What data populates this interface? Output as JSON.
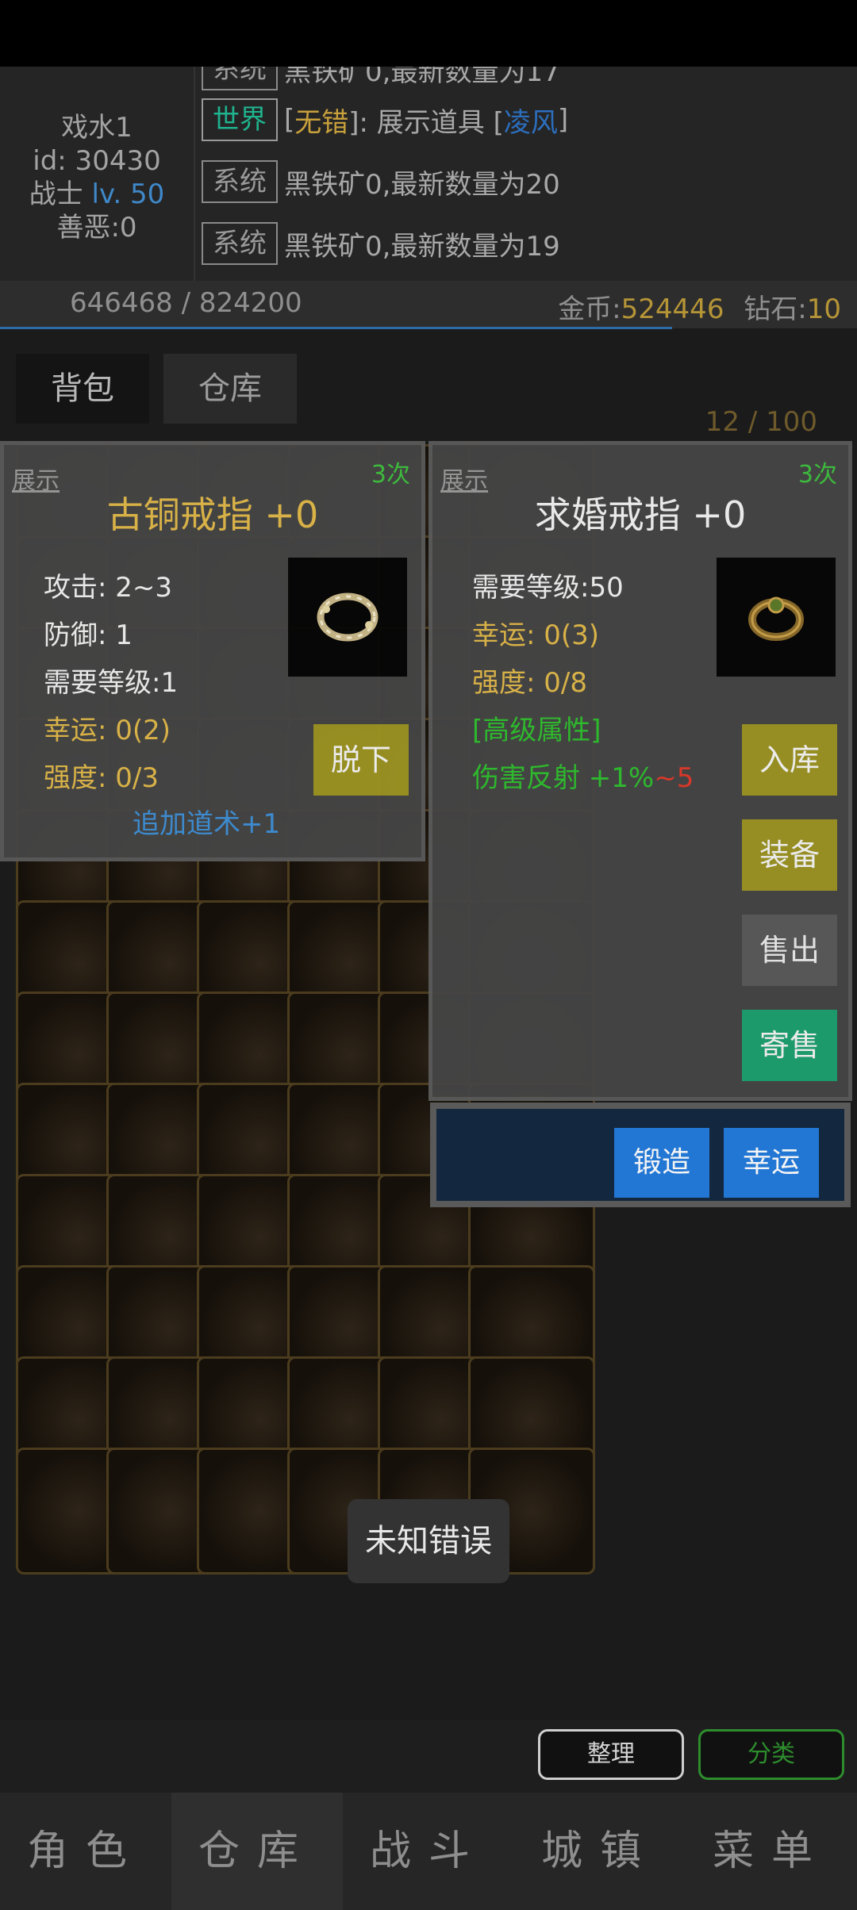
{
  "character": {
    "name": "戏水1",
    "id": "id: 30430",
    "class": "战士",
    "level": "lv. 50",
    "karma": "善恶:0"
  },
  "chat": [
    {
      "tag": "系统",
      "text": "黑铁矿0,最新数量为17",
      "partial": true
    },
    {
      "tag": "世界",
      "prefix": "[",
      "name": "无错",
      "mid": "]: 展示道具 [",
      "item": "凌风",
      "suffix": "]"
    },
    {
      "tag": "系统",
      "text": "黑铁矿0,最新数量为20"
    },
    {
      "tag": "系统",
      "text": "黑铁矿0,最新数量为19"
    }
  ],
  "stats": {
    "exp": "646468 / 824200",
    "gold_label": "金币:",
    "gold": "524446",
    "diamond_label": "钻石:",
    "diamond": "10",
    "exp_progress": 0.784
  },
  "tabs": {
    "bag": "背包",
    "warehouse": "仓库"
  },
  "capacity": "12 / 100",
  "left_item": {
    "showcase": "展示",
    "times": "3次",
    "title": "古铜戒指 +0",
    "attack": "攻击: 2~3",
    "defense": "防御: 1",
    "level_req": "需要等级:1",
    "luck": "幸运: 0(2)",
    "strength": "强度: 0/3",
    "bonus": "追加道术+1",
    "unequip": "脱下"
  },
  "right_item": {
    "showcase": "展示",
    "times": "3次",
    "title": "求婚戒指 +0",
    "level_req": "需要等级:50",
    "luck": "幸运: 0(3)",
    "strength": "强度: 0/8",
    "advanced": "[高级属性]",
    "reflect": "伤害反射 +1%",
    "reflect_max": "~5",
    "store": "入库",
    "equip": "装备",
    "sell": "售出",
    "consign": "寄售",
    "forge": "锻造",
    "luck_btn": "幸运"
  },
  "toast": "未知错误",
  "actions": {
    "sort": "整理",
    "classify": "分类"
  },
  "nav": [
    "角色",
    "仓库",
    "战斗",
    "城镇",
    "菜单"
  ],
  "colors": {
    "accent_gold": "#c8a03c",
    "world_tag": "#1fb38e",
    "button_olive": "#9c9323",
    "button_blue": "#2377d4",
    "button_green": "#1ea070"
  }
}
